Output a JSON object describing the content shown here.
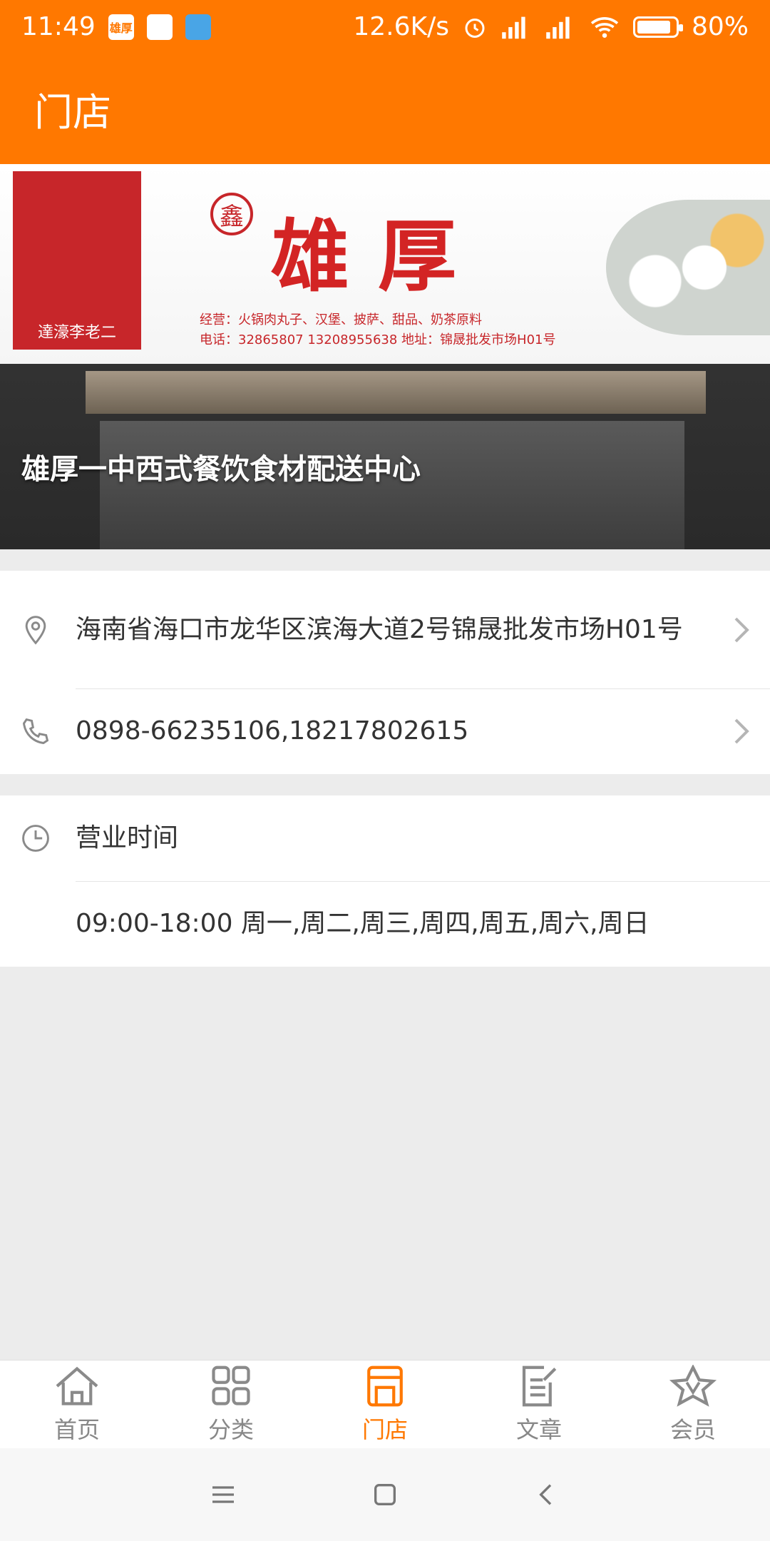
{
  "status_bar": {
    "time": "11:49",
    "app_icon_label": "雄厚",
    "speed": "12.6K/s",
    "battery": "80%"
  },
  "app_bar": {
    "title": "门店"
  },
  "hero": {
    "caption": "雄厚一中西式餐饮食材配送中心",
    "sign": {
      "left_brand": "達濠李老二",
      "badge": "鑫",
      "title": "雄厚",
      "line1": "经营：火锅肉丸子、汉堡、披萨、甜品、奶茶原料",
      "line2": "电话：32865807 13208955638 地址：锦晟批发市场H01号"
    }
  },
  "store_info": {
    "address": "海南省海口市龙华区滨海大道2号锦晟批发市场H01号",
    "phone": "0898-66235106,18217802615"
  },
  "hours": {
    "title": "营业时间",
    "value": "09:00-18:00 周一,周二,周三,周四,周五,周六,周日"
  },
  "tabs": [
    {
      "label": "首页",
      "icon": "home-icon"
    },
    {
      "label": "分类",
      "icon": "grid-icon"
    },
    {
      "label": "门店",
      "icon": "store-icon",
      "active": true
    },
    {
      "label": "文章",
      "icon": "article-icon"
    },
    {
      "label": "会员",
      "icon": "star-icon"
    }
  ],
  "colors": {
    "primary": "#ff7800",
    "background": "#ececec"
  }
}
